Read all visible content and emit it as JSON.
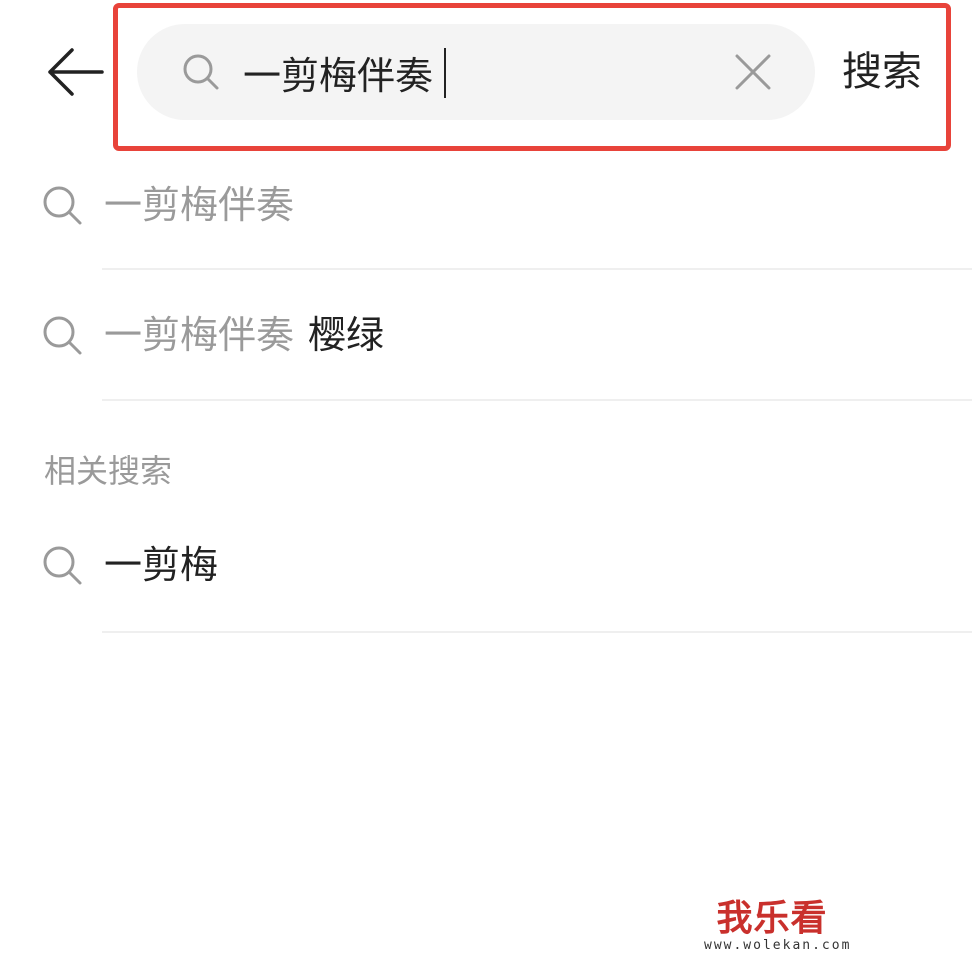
{
  "header": {
    "search_query": "一剪梅伴奏",
    "search_button_label": "搜索",
    "highlight_color": "#e8433a"
  },
  "suggestions": [
    {
      "query": "一剪梅伴奏",
      "suffix": ""
    },
    {
      "query": "一剪梅伴奏",
      "suffix": "樱绿"
    }
  ],
  "related": {
    "title": "相关搜索",
    "items": [
      {
        "text": "一剪梅"
      }
    ]
  },
  "watermark": {
    "title": "我乐看",
    "url": "www.wolekan.com"
  },
  "icons": [
    "back-arrow-icon",
    "search-icon",
    "clear-icon"
  ]
}
